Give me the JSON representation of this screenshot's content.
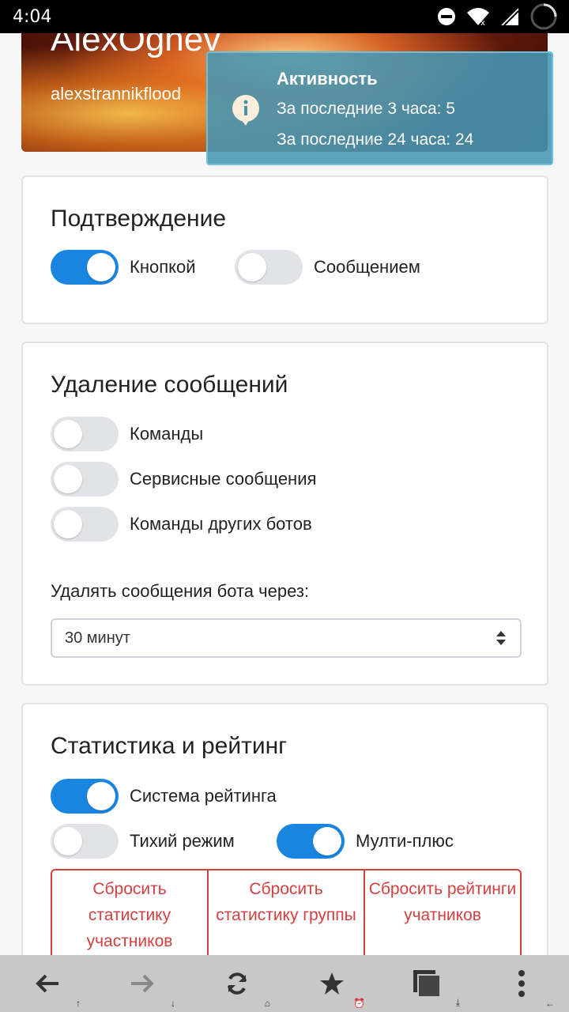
{
  "status": {
    "time": "4:04"
  },
  "profile": {
    "name": "AlexOgnev",
    "username": "alexstrannikflood"
  },
  "activity": {
    "title": "Активность",
    "line1": "За последние 3 часа: 5",
    "line2": "За последние 24 часа: 24"
  },
  "confirmation": {
    "title": "Подтверждение",
    "by_button": {
      "label": "Кнопкой",
      "on": true
    },
    "by_message": {
      "label": "Сообщением",
      "on": false
    }
  },
  "deletion": {
    "title": "Удаление сообщений",
    "commands": {
      "label": "Команды",
      "on": false
    },
    "service": {
      "label": "Сервисные сообщения",
      "on": false
    },
    "other_bots": {
      "label": "Команды других ботов",
      "on": false
    },
    "delay_label": "Удалять сообщения бота через:",
    "delay_value": "30 минут"
  },
  "stats": {
    "title": "Статистика и рейтинг",
    "rating_system": {
      "label": "Система рейтинга",
      "on": true
    },
    "quiet_mode": {
      "label": "Тихий режим",
      "on": false
    },
    "multi_plus": {
      "label": "Мулти-плюс",
      "on": true
    },
    "reset_members_stats": "Сбросить статистику участников",
    "reset_group_stats": "Сбросить статистику группы",
    "reset_ratings": "Сбросить рейтинги учатников"
  },
  "colors": {
    "accent": "#1a85e0",
    "danger": "#d54040",
    "popup": "#4696b4"
  },
  "bottom_nav": [
    {
      "icon": "back-arrow-icon",
      "sub": "↑"
    },
    {
      "icon": "forward-arrow-icon",
      "sub": "↓"
    },
    {
      "icon": "refresh-icon",
      "sub": "home"
    },
    {
      "icon": "star-icon",
      "sub": "alarm"
    },
    {
      "icon": "tabs-icon",
      "sub": "download"
    },
    {
      "icon": "more-vertical-icon",
      "sub": "←"
    }
  ]
}
